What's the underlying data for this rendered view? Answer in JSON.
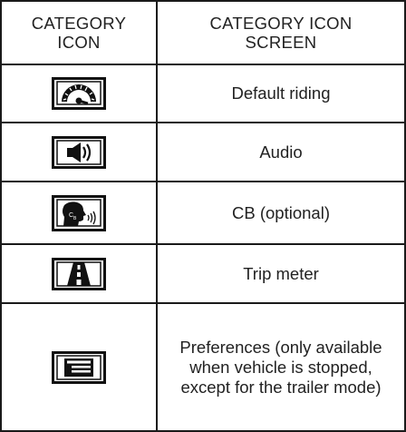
{
  "table": {
    "headers": {
      "icon": "CATEGORY ICON",
      "screen": "CATEGORY ICON SCREEN"
    },
    "rows": [
      {
        "icon": "speedometer-icon",
        "label": "Default riding"
      },
      {
        "icon": "speaker-icon",
        "label": "Audio"
      },
      {
        "icon": "cb-talking-head-icon",
        "label": "CB (optional)"
      },
      {
        "icon": "road-icon",
        "label": "Trip meter"
      },
      {
        "icon": "preferences-list-icon",
        "label": "Preferences (only available when vehicle is stopped, except for the trailer mode)"
      }
    ]
  }
}
